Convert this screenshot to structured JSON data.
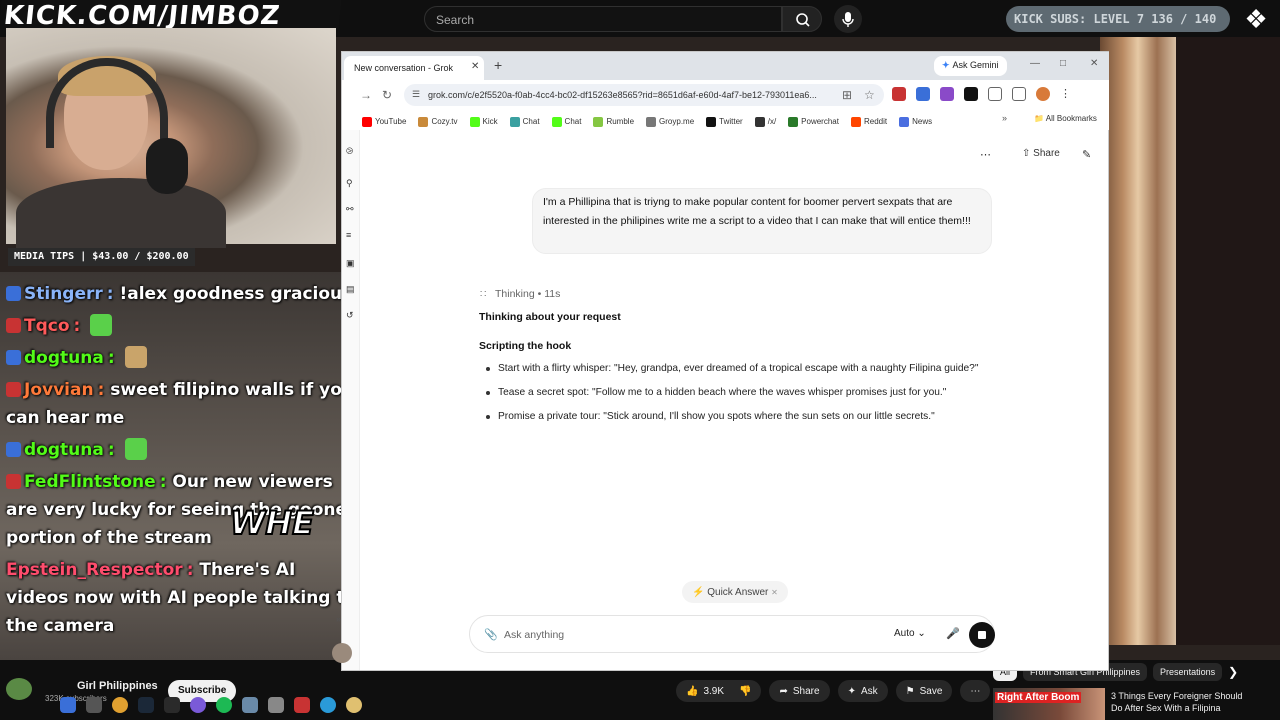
{
  "stream": {
    "kick_url": "KICK.COM/JIMBOZ",
    "kick_subs": "KICK SUBS: LEVEL 7 136 / 140",
    "media_tips": "MEDIA TIPS | $43.00 / $200.00",
    "overlay_text": "WHE",
    "chat": [
      {
        "user": "Stingerr",
        "user_color": "#8ab4f8",
        "message": "!alex goodness gracious",
        "badge_color": "#3a6fd8"
      },
      {
        "user": "Tqco",
        "user_color": "#ff5a5a",
        "message": "",
        "badge_color": "#c83333"
      },
      {
        "user": "dogtuna",
        "user_color": "#53fc18",
        "message": "",
        "badge_color": "#3a6fd8"
      },
      {
        "user": "Jovvian",
        "user_color": "#ff7a3a",
        "message": "sweet filipino walls if you can hear me",
        "badge_color": "#c83333"
      },
      {
        "user": "dogtuna",
        "user_color": "#53fc18",
        "message": "",
        "badge_color": "#3a6fd8"
      },
      {
        "user": "FedFlintstone",
        "user_color": "#53fc18",
        "message": "Our new viewers are very lucky for seeing the gooner portion of the stream",
        "badge_color": "#c83333"
      },
      {
        "user": "Epstein_Respector",
        "user_color": "#ff4d6d",
        "message": "There's AI videos now with AI people talking to the camera",
        "badge_color": ""
      }
    ]
  },
  "youtube": {
    "search_placeholder": "Search",
    "channel_name": "Girl Philippines",
    "subscribers": "323K subscribers",
    "subscribe_label": "Subscribe",
    "likes": "3.9K",
    "share_label": "Share",
    "ask_label": "Ask",
    "save_label": "Save",
    "chips": [
      "All",
      "From Smart Girl Philippines",
      "Presentations"
    ],
    "rec_badge": "Right After Boom",
    "rec_title": "3 Things Every Foreigner Should Do After Sex With a Filipina"
  },
  "browser": {
    "tab_title": "New conversation - Grok",
    "ask_gemini": "Ask Gemini",
    "url": "grok.com/c/e2f5520a-f0ab-4cc4-bc02-df15263e8565?rid=8651d6af-e60d-4af7-be12-793011ea6...",
    "bookmarks": [
      "YouTube",
      "Cozy.tv",
      "Kick",
      "Chat",
      "Chat",
      "Rumble",
      "Groyp.me",
      "Twitter",
      "/x/",
      "Powerchat",
      "Reddit",
      "News"
    ],
    "bookmark_colors": [
      "#ff0000",
      "#c98a3a",
      "#53fc18",
      "#3aa0a0",
      "#53fc18",
      "#85c742",
      "#777777",
      "#111111",
      "#333333",
      "#2a7a2a",
      "#ff4500",
      "#4a6ee0"
    ],
    "all_bookmarks": "All Bookmarks"
  },
  "grok": {
    "share_label": "Share",
    "user_message": "I'm a Phillipina that is triyng to make popular content for boomer pervert sexpats that are interested in the philipines write me a script to a video that I can make that will entice them!!!",
    "thinking_label": "Thinking • 11s",
    "section1": "Thinking about your request",
    "section2": "Scripting the hook",
    "bullets": [
      "Start with a flirty whisper: \"Hey, grandpa, ever dreamed of a tropical escape with a naughty Filipina guide?\"",
      "Tease a secret spot: \"Follow me to a hidden beach where the waves whisper promises just for you.\"",
      "Promise a private tour: \"Stick around, I'll show you spots where the sun sets on our little secrets.\""
    ],
    "quick_answer": "Quick Answer",
    "ask_placeholder": "Ask anything",
    "mode": "Auto"
  },
  "icons": [
    "search-icon",
    "mic-icon",
    "close-icon",
    "plus-icon",
    "reload-icon",
    "bookmark-star-icon",
    "more-icon",
    "share-icon",
    "edit-icon",
    "paperclip-icon",
    "stop-icon",
    "like-icon",
    "dislike-icon"
  ]
}
